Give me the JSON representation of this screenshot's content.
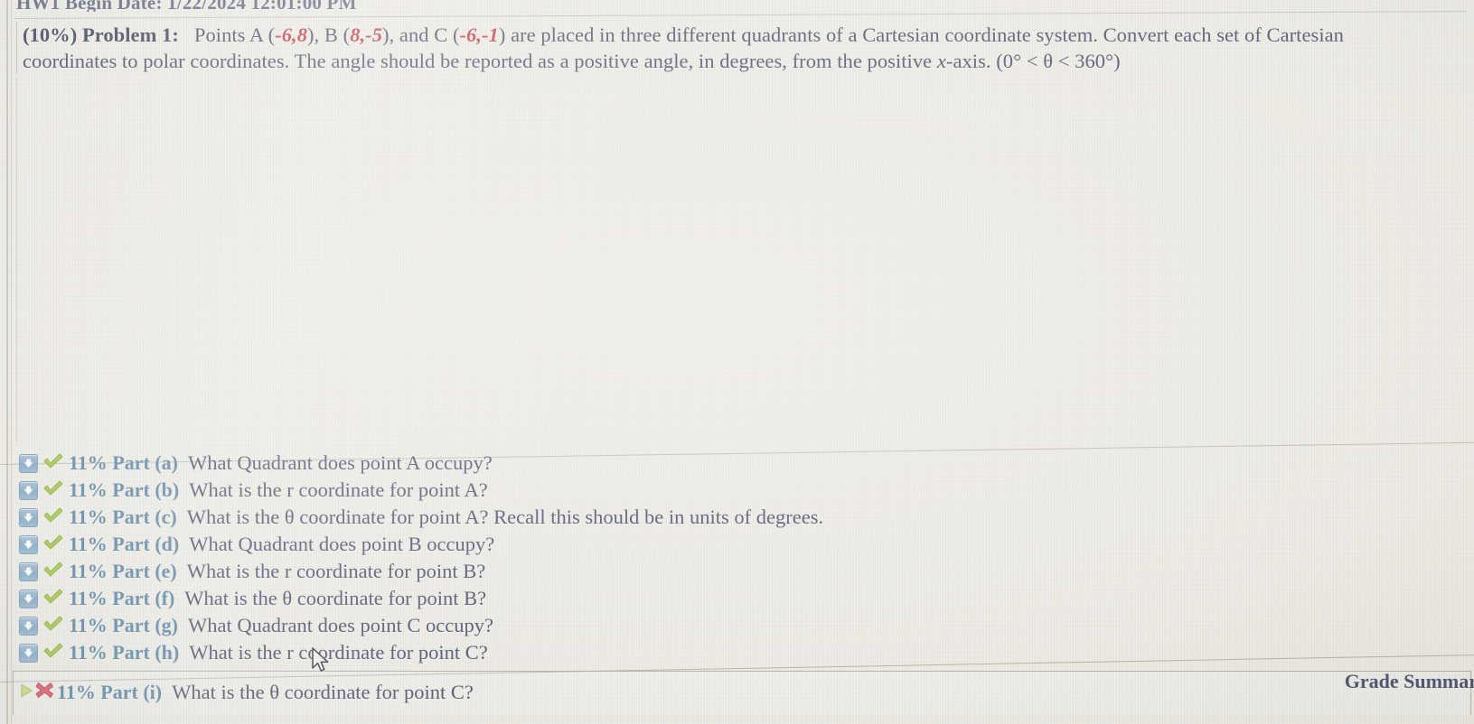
{
  "header": {
    "cut_off_text": "HW1 Begin Date: 1/22/2024 12:01:00 PM"
  },
  "problem": {
    "weight": "(10%)",
    "title": "Problem 1:",
    "line1_pre": "Points A (",
    "point_a": "-6,8",
    "line1_mid1": "), B (",
    "point_b": "8,-5",
    "line1_mid2": "), and C (",
    "point_c": "-6,-1",
    "line1_post": ") are placed in three different quadrants of a Cartesian coordinate system. Convert each set of Cartesian",
    "line2_pre": "coordinates to polar coordinates. The angle should be reported as a positive angle, in degrees, from the positive ",
    "line2_var": "x",
    "line2_post": "-axis. (0° < θ < 360°)"
  },
  "parts": [
    {
      "label": "11% Part (a)",
      "text": "What Quadrant does point A occupy?",
      "status": "correct",
      "toggle": "expand-down"
    },
    {
      "label": "11% Part (b)",
      "text": "What is the r coordinate for point A?",
      "status": "correct",
      "toggle": "expand-down"
    },
    {
      "label": "11% Part (c)",
      "text": "What is the θ coordinate for point A? Recall this should be in units of degrees.",
      "status": "correct",
      "toggle": "expand-down"
    },
    {
      "label": "11% Part (d)",
      "text": "What Quadrant does point B occupy?",
      "status": "correct",
      "toggle": "expand-down"
    },
    {
      "label": "11% Part (e)",
      "text": "What is the r coordinate for point B?",
      "status": "correct",
      "toggle": "expand-down"
    },
    {
      "label": "11% Part (f)",
      "text": "What is the θ coordinate for point B?",
      "status": "correct",
      "toggle": "expand-down"
    },
    {
      "label": "11% Part (g)",
      "text": "What Quadrant does point C occupy?",
      "status": "correct",
      "toggle": "expand-down"
    },
    {
      "label": "11% Part (h)",
      "text": "What is the r coordinate for point C?",
      "status": "correct",
      "toggle": "expand-down"
    }
  ],
  "active_part": {
    "label": "11% Part (i)",
    "text": "What is the θ coordinate for point C?",
    "status": "incorrect",
    "toggle": "play-right"
  },
  "footer": {
    "grade_summary": "Grade Summar"
  },
  "colors": {
    "page_background": "#eeece6",
    "problem_text": "#4b4f6b",
    "coordinate_highlight": "#c33a4a",
    "part_label": "#5e88a8",
    "correct_mark": "#9ec441",
    "incorrect_mark": "#d9566a",
    "toggle_button": "#86a9c6"
  }
}
